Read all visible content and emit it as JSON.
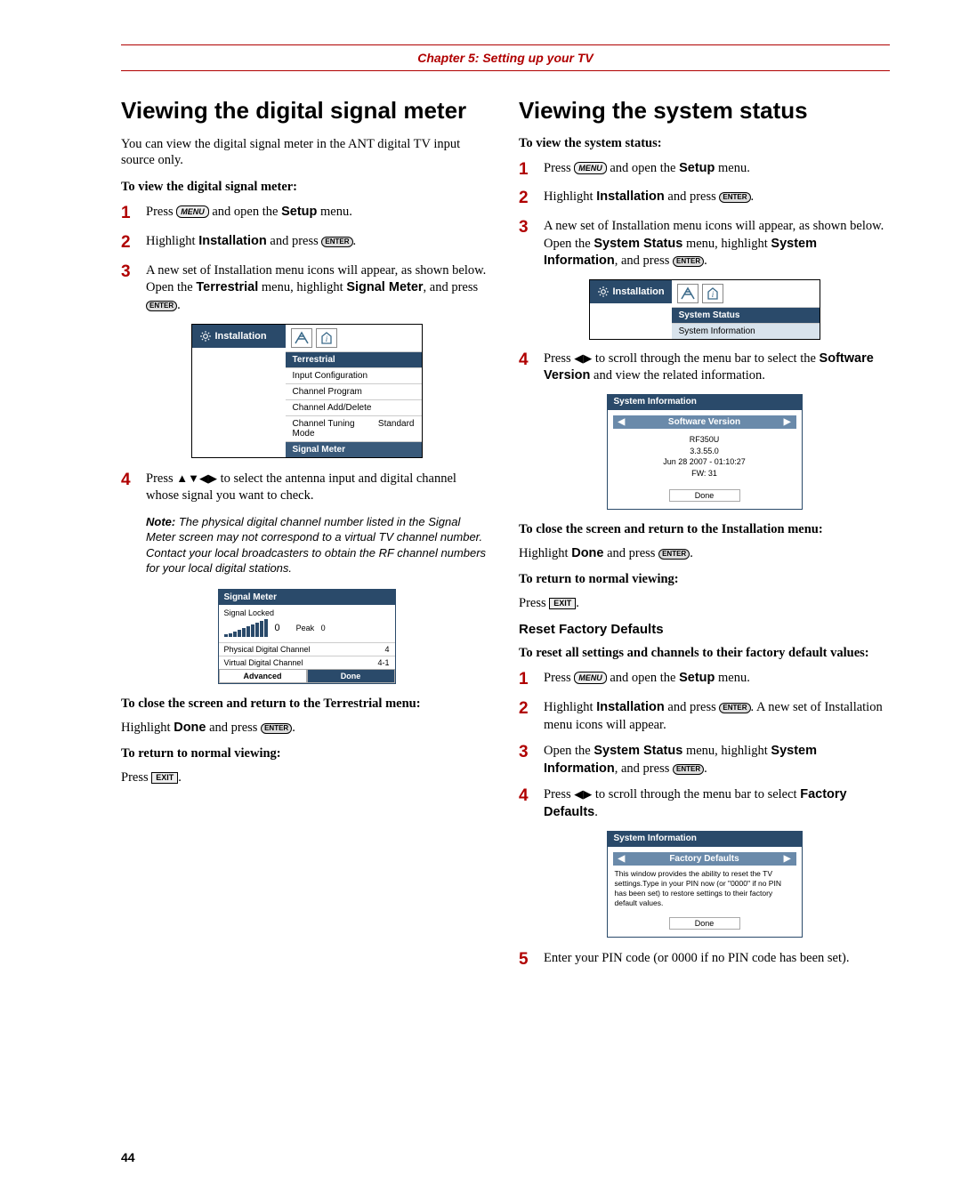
{
  "chapter": "Chapter 5: Setting up your TV",
  "icons": {
    "menu": "MENU",
    "enter": "ENTER",
    "exit": "EXIT"
  },
  "left": {
    "heading": "Viewing the digital signal meter",
    "intro": "You can view the digital signal meter in the ANT digital TV input source only.",
    "sub1": "To view the digital signal meter:",
    "steps": {
      "s1a": "Press ",
      "s1b": " and open the ",
      "s1c": "Setup",
      "s1d": " menu.",
      "s2a": "Highlight ",
      "s2b": "Installation",
      "s2c": " and press ",
      "s3a": "A new set of Installation menu icons will appear, as shown below. Open the ",
      "s3b": "Terrestrial",
      "s3c": " menu, highlight ",
      "s3d": "Signal Meter",
      "s3e": ", and press ",
      "s4a": "Press ",
      "s4arrows": "▲▼◀▶",
      "s4b": " to select the antenna input and digital channel whose signal you want to check."
    },
    "menu": {
      "tab": "Installation",
      "rows": [
        "Terrestrial",
        "Input Configuration",
        "Channel Program",
        "Channel Add/Delete",
        "Channel Tuning Mode",
        "Signal Meter"
      ],
      "tuning_val": "Standard"
    },
    "note_label": "Note:",
    "note": " The physical digital channel number listed in the Signal Meter screen may not correspond to a virtual TV channel number. Contact your local broadcasters to obtain the RF channel numbers for your local digital stations.",
    "signal": {
      "title": "Signal Meter",
      "locked": "Signal Locked",
      "zero": "0",
      "peak": "Peak",
      "peak_val": "0",
      "rows": [
        {
          "l": "Physical Digital Channel",
          "r": "4"
        },
        {
          "l": "Virtual Digital Channel",
          "r": "4-1"
        }
      ],
      "advanced": "Advanced",
      "done": "Done"
    },
    "close_heading": "To close the screen and return to the Terrestrial menu:",
    "close_text_a": "Highlight ",
    "close_text_b": "Done",
    "close_text_c": " and press ",
    "return_heading": "To return to normal viewing:",
    "return_text": "Press "
  },
  "right": {
    "heading": "Viewing the system status",
    "sub1": "To view the system status:",
    "steps": {
      "s1a": "Press ",
      "s1b": " and open the ",
      "s1c": "Setup",
      "s1d": " menu.",
      "s2a": "Highlight ",
      "s2b": "Installation",
      "s2c": " and press ",
      "s3a": "A new set of Installation menu icons will appear, as shown below. Open the ",
      "s3b": "System Status",
      "s3c": " menu, highlight ",
      "s3d": "System Information",
      "s3e": ", and press ",
      "s4a": "Press ",
      "s4arrows": "◀▶",
      "s4b": " to scroll through the menu bar to select the ",
      "s4c": "Software Version",
      "s4d": " and view the related information."
    },
    "menu": {
      "tab": "Installation",
      "rows": [
        "System Status",
        "System Information"
      ]
    },
    "sys": {
      "title": "System Information",
      "scroll_label": "Software Version",
      "l1": "RF350U",
      "l2": "3.3.55.0",
      "l3": "Jun 28 2007 - 01:10:27",
      "l4": "FW:  31",
      "done": "Done"
    },
    "close_heading": "To close the screen and return to the Installation menu:",
    "close_text_a": "Highlight ",
    "close_text_b": "Done",
    "close_text_c": " and press ",
    "return_heading": "To return to normal viewing:",
    "return_text": "Press ",
    "reset_heading": "Reset Factory Defaults",
    "reset_sub": "To reset all settings and channels to their factory default values:",
    "reset_steps": {
      "s1a": "Press ",
      "s1b": " and open the ",
      "s1c": "Setup",
      "s1d": " menu.",
      "s2a": "Highlight ",
      "s2b": "Installation",
      "s2c": " and press ",
      "s2d": ". A new set of Installation menu icons will appear.",
      "s3a": "Open the ",
      "s3b": "System Status",
      "s3c": " menu, highlight ",
      "s3d": "System Information",
      "s3e": ", and press ",
      "s4a": "Press ",
      "s4arrows": "◀▶",
      "s4b": " to scroll through the menu bar to select ",
      "s4c": "Factory Defaults",
      "s4d": ".",
      "s5a": "Enter your PIN code (or 0000 if no PIN code has been set)."
    },
    "factory": {
      "title": "System Information",
      "scroll_label": "Factory Defaults",
      "text": "This window provides the ability to reset the TV settings.Type in your PIN now  (or \"0000\"  if no PIN has been set) to restore settings to their factory default values.",
      "done": "Done"
    }
  },
  "page_num": "44"
}
